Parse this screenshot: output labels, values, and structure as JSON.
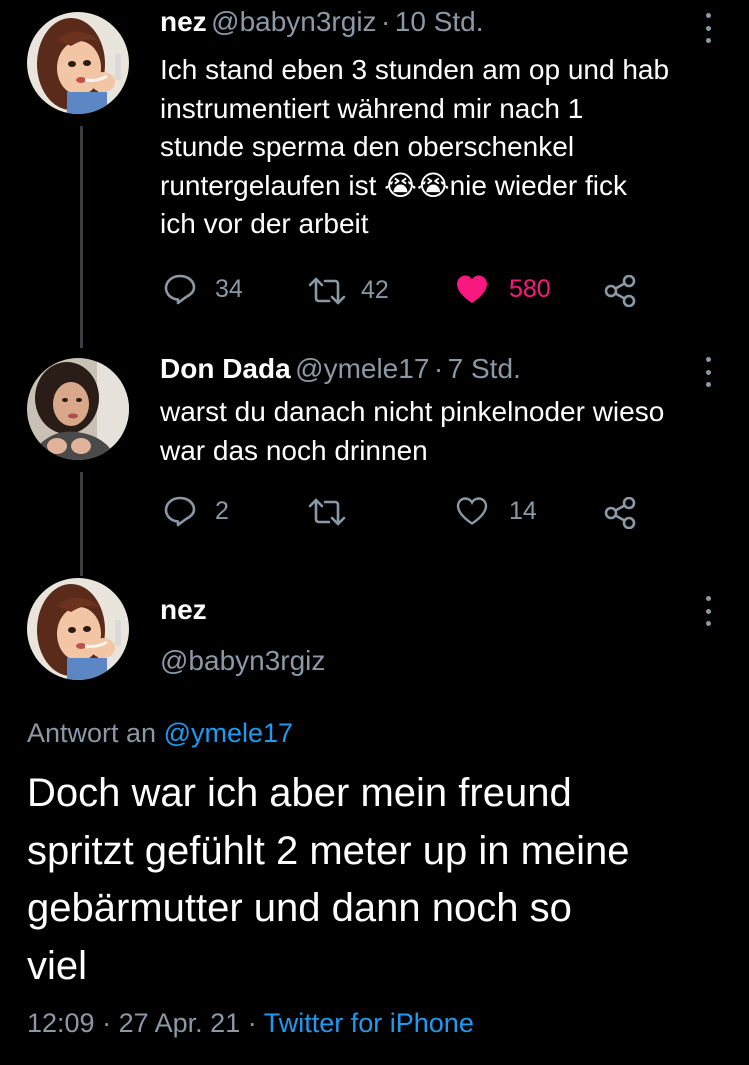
{
  "tweet1": {
    "name": "nez",
    "handle": "@babyn3rgiz",
    "sep": "·",
    "time": "10 Std.",
    "lines": [
      "Ich stand eben 3 stunden am op und hab",
      "instrumentiert während mir nach 1",
      "stunde sperma den oberschenkel",
      "runtergelaufen ist 😭😭nie wieder fick",
      "ich vor der arbeit"
    ],
    "replies": "34",
    "retweets": "42",
    "likes": "580",
    "liked": true
  },
  "tweet2": {
    "name": "Don Dada",
    "handle": "@ymele17",
    "sep": "·",
    "time": "7 Std.",
    "lines": [
      "warst du danach nicht pinkelnoder wieso",
      "war das noch drinnen"
    ],
    "replies": "2",
    "likes": "14"
  },
  "main": {
    "name": "nez",
    "handle": "@babyn3rgiz",
    "reply_prefix": "Antwort an",
    "reply_to": "@ymele17",
    "lines": [
      "Doch war ich aber mein freund",
      "spritzt gefühlt 2 meter up in meine",
      "gebärmutter und dann noch so",
      "viel"
    ],
    "time": "12:09",
    "date": "27 Apr. 21",
    "sep": "·",
    "source": "Twitter for iPhone"
  },
  "colors": {
    "background": "#000000",
    "secondary_text": "#8b98a5",
    "link": "#1d9bf0",
    "like": "#f91880"
  },
  "icons": [
    "reply-icon",
    "retweet-icon",
    "heart-icon",
    "share-icon",
    "more-icon"
  ]
}
